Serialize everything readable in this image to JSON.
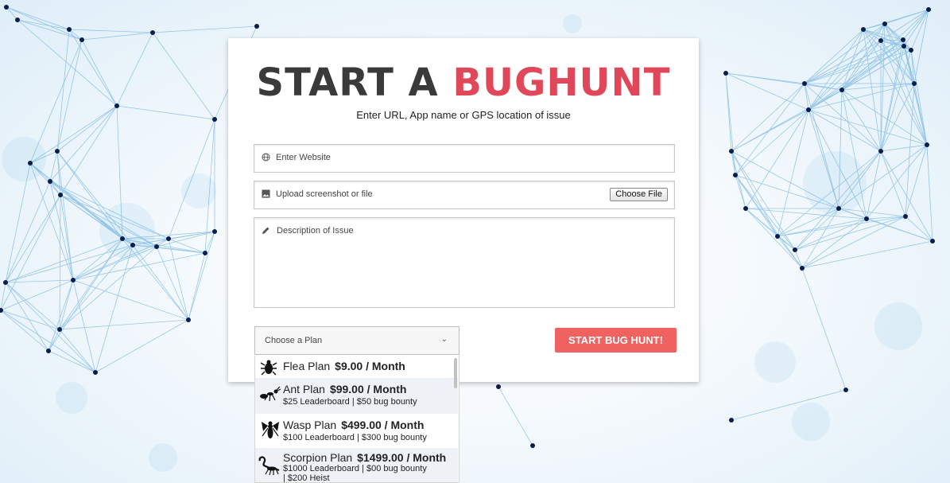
{
  "header": {
    "title_main": "START A ",
    "title_accent": "BUGHUNT",
    "subtitle": "Enter URL, App name or GPS location of issue"
  },
  "form": {
    "website": {
      "placeholder": "Enter Website",
      "icon": "globe-icon"
    },
    "upload": {
      "placeholder": "Upload screenshot or file",
      "icon": "image-icon",
      "button": "Choose File"
    },
    "description": {
      "placeholder": "Description of Issue",
      "icon": "pencil-icon"
    },
    "plan_select": {
      "placeholder": "Choose a Plan"
    },
    "submit": "START BUG HUNT!"
  },
  "plans": [
    {
      "name": "Flea Plan",
      "price": "$9.00 / Month",
      "details": []
    },
    {
      "name": "Ant Plan",
      "price": "$99.00 / Month",
      "details": [
        "$25 Leaderboard | $50 bug bounty"
      ]
    },
    {
      "name": "Wasp Plan",
      "price": "$499.00 / Month",
      "details": [
        "$100 Leaderboard | $300 bug bounty"
      ]
    },
    {
      "name": "Scorpion Plan",
      "price": "$1499.00 / Month",
      "details": [
        "$1000 Leaderboard | $00 bug bounty",
        "| $200 Heist"
      ]
    }
  ],
  "colors": {
    "accent": "#e0485a",
    "button": "#ef6260",
    "title": "#3a3a3a"
  }
}
